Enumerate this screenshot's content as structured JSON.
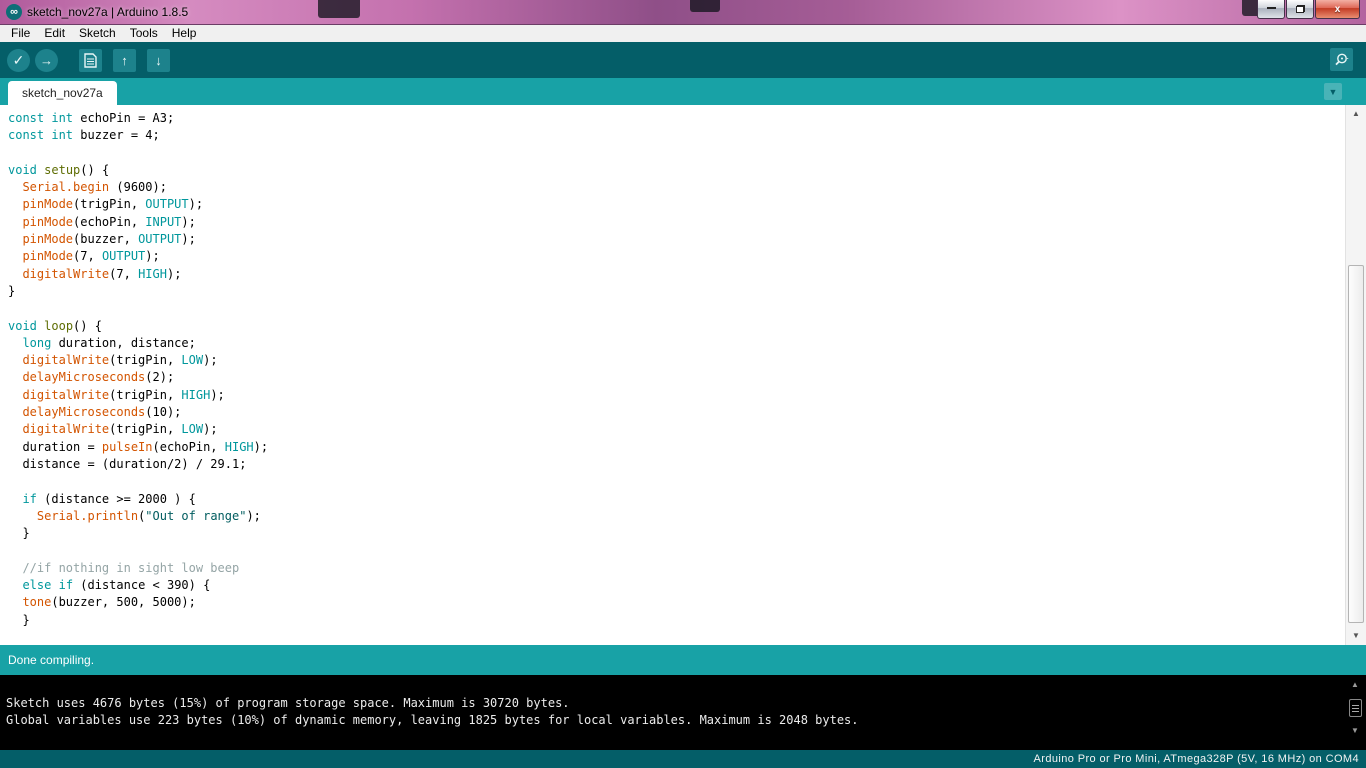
{
  "window": {
    "title": "sketch_nov27a | Arduino 1.8.5"
  },
  "icons": {
    "logo": "∞",
    "close": "x",
    "verify": "✓",
    "upload": "→",
    "open": "↑",
    "save": "↓",
    "dropdown": "▼",
    "scroll_up": "▲",
    "scroll_down": "▼"
  },
  "menubar": {
    "items": [
      "File",
      "Edit",
      "Sketch",
      "Tools",
      "Help"
    ]
  },
  "tabbar": {
    "active_tab": "sketch_nov27a"
  },
  "editor": {
    "code_lines": [
      [
        [
          "kw",
          "const"
        ],
        [
          "pl",
          " "
        ],
        [
          "kw",
          "int"
        ],
        [
          "pl",
          " echoPin = A3;"
        ]
      ],
      [
        [
          "kw",
          "const"
        ],
        [
          "pl",
          " "
        ],
        [
          "kw",
          "int"
        ],
        [
          "pl",
          " buzzer = 4;"
        ]
      ],
      [],
      [
        [
          "kw",
          "void"
        ],
        [
          "pl",
          " "
        ],
        [
          "fn2",
          "setup"
        ],
        [
          "pl",
          "() {"
        ]
      ],
      [
        [
          "pl",
          "  "
        ],
        [
          "fn",
          "Serial.begin"
        ],
        [
          "pl",
          " (9600);"
        ]
      ],
      [
        [
          "pl",
          "  "
        ],
        [
          "fn",
          "pinMode"
        ],
        [
          "pl",
          "(trigPin, "
        ],
        [
          "kw",
          "OUTPUT"
        ],
        [
          "pl",
          ");"
        ]
      ],
      [
        [
          "pl",
          "  "
        ],
        [
          "fn",
          "pinMode"
        ],
        [
          "pl",
          "(echoPin, "
        ],
        [
          "kw",
          "INPUT"
        ],
        [
          "pl",
          ");"
        ]
      ],
      [
        [
          "pl",
          "  "
        ],
        [
          "fn",
          "pinMode"
        ],
        [
          "pl",
          "(buzzer, "
        ],
        [
          "kw",
          "OUTPUT"
        ],
        [
          "pl",
          ");"
        ]
      ],
      [
        [
          "pl",
          "  "
        ],
        [
          "fn",
          "pinMode"
        ],
        [
          "pl",
          "(7, "
        ],
        [
          "kw",
          "OUTPUT"
        ],
        [
          "pl",
          ");"
        ]
      ],
      [
        [
          "pl",
          "  "
        ],
        [
          "fn",
          "digitalWrite"
        ],
        [
          "pl",
          "(7, "
        ],
        [
          "kw",
          "HIGH"
        ],
        [
          "pl",
          ");"
        ]
      ],
      [
        [
          "pl",
          "}"
        ]
      ],
      [],
      [
        [
          "kw",
          "void"
        ],
        [
          "pl",
          " "
        ],
        [
          "fn2",
          "loop"
        ],
        [
          "pl",
          "() {"
        ]
      ],
      [
        [
          "pl",
          "  "
        ],
        [
          "kw",
          "long"
        ],
        [
          "pl",
          " duration, distance;"
        ]
      ],
      [
        [
          "pl",
          "  "
        ],
        [
          "fn",
          "digitalWrite"
        ],
        [
          "pl",
          "(trigPin, "
        ],
        [
          "kw",
          "LOW"
        ],
        [
          "pl",
          ");"
        ]
      ],
      [
        [
          "pl",
          "  "
        ],
        [
          "fn",
          "delayMicroseconds"
        ],
        [
          "pl",
          "(2);"
        ]
      ],
      [
        [
          "pl",
          "  "
        ],
        [
          "fn",
          "digitalWrite"
        ],
        [
          "pl",
          "(trigPin, "
        ],
        [
          "kw",
          "HIGH"
        ],
        [
          "pl",
          ");"
        ]
      ],
      [
        [
          "pl",
          "  "
        ],
        [
          "fn",
          "delayMicroseconds"
        ],
        [
          "pl",
          "(10);"
        ]
      ],
      [
        [
          "pl",
          "  "
        ],
        [
          "fn",
          "digitalWrite"
        ],
        [
          "pl",
          "(trigPin, "
        ],
        [
          "kw",
          "LOW"
        ],
        [
          "pl",
          ");"
        ]
      ],
      [
        [
          "pl",
          "  duration = "
        ],
        [
          "fn",
          "pulseIn"
        ],
        [
          "pl",
          "(echoPin, "
        ],
        [
          "kw",
          "HIGH"
        ],
        [
          "pl",
          ");"
        ]
      ],
      [
        [
          "pl",
          "  distance = (duration/2) / 29.1;"
        ]
      ],
      [],
      [
        [
          "pl",
          "  "
        ],
        [
          "kw",
          "if"
        ],
        [
          "pl",
          " (distance >= 2000 ) {"
        ]
      ],
      [
        [
          "pl",
          "    "
        ],
        [
          "fn",
          "Serial.println"
        ],
        [
          "pl",
          "("
        ],
        [
          "str",
          "\"Out of range\""
        ],
        [
          "pl",
          ");"
        ]
      ],
      [
        [
          "pl",
          "  }"
        ]
      ],
      [],
      [
        [
          "pl",
          "  "
        ],
        [
          "cmt",
          "//if nothing in sight low beep"
        ]
      ],
      [
        [
          "pl",
          "  "
        ],
        [
          "kw",
          "else"
        ],
        [
          "pl",
          " "
        ],
        [
          "kw",
          "if"
        ],
        [
          "pl",
          " (distance < 390) {"
        ]
      ],
      [
        [
          "pl",
          "  "
        ],
        [
          "fn",
          "tone"
        ],
        [
          "pl",
          "(buzzer, 500, 5000);"
        ]
      ],
      [
        [
          "pl",
          "  }"
        ]
      ]
    ]
  },
  "statusbar": {
    "message": "Done compiling."
  },
  "console": {
    "lines": [
      "Sketch uses 4676 bytes (15%) of program storage space. Maximum is 30720 bytes.",
      "Global variables use 223 bytes (10%) of dynamic memory, leaving 1825 bytes for local variables. Maximum is 2048 bytes."
    ]
  },
  "bottombar": {
    "board_info": "Arduino Pro or Pro Mini, ATmega328P (5V, 16 MHz) on COM4"
  },
  "colors": {
    "toolbar_bg": "#045e68",
    "tabbar_bg": "#18a2a6",
    "statusbar_bg": "#18a2a6",
    "bottombar_bg": "#045e68",
    "keyword": "#00979c",
    "function": "#d35400",
    "known_function": "#5e6d03",
    "string": "#005c5f",
    "comment": "#95a5a6",
    "close_button": "#c23a23"
  }
}
